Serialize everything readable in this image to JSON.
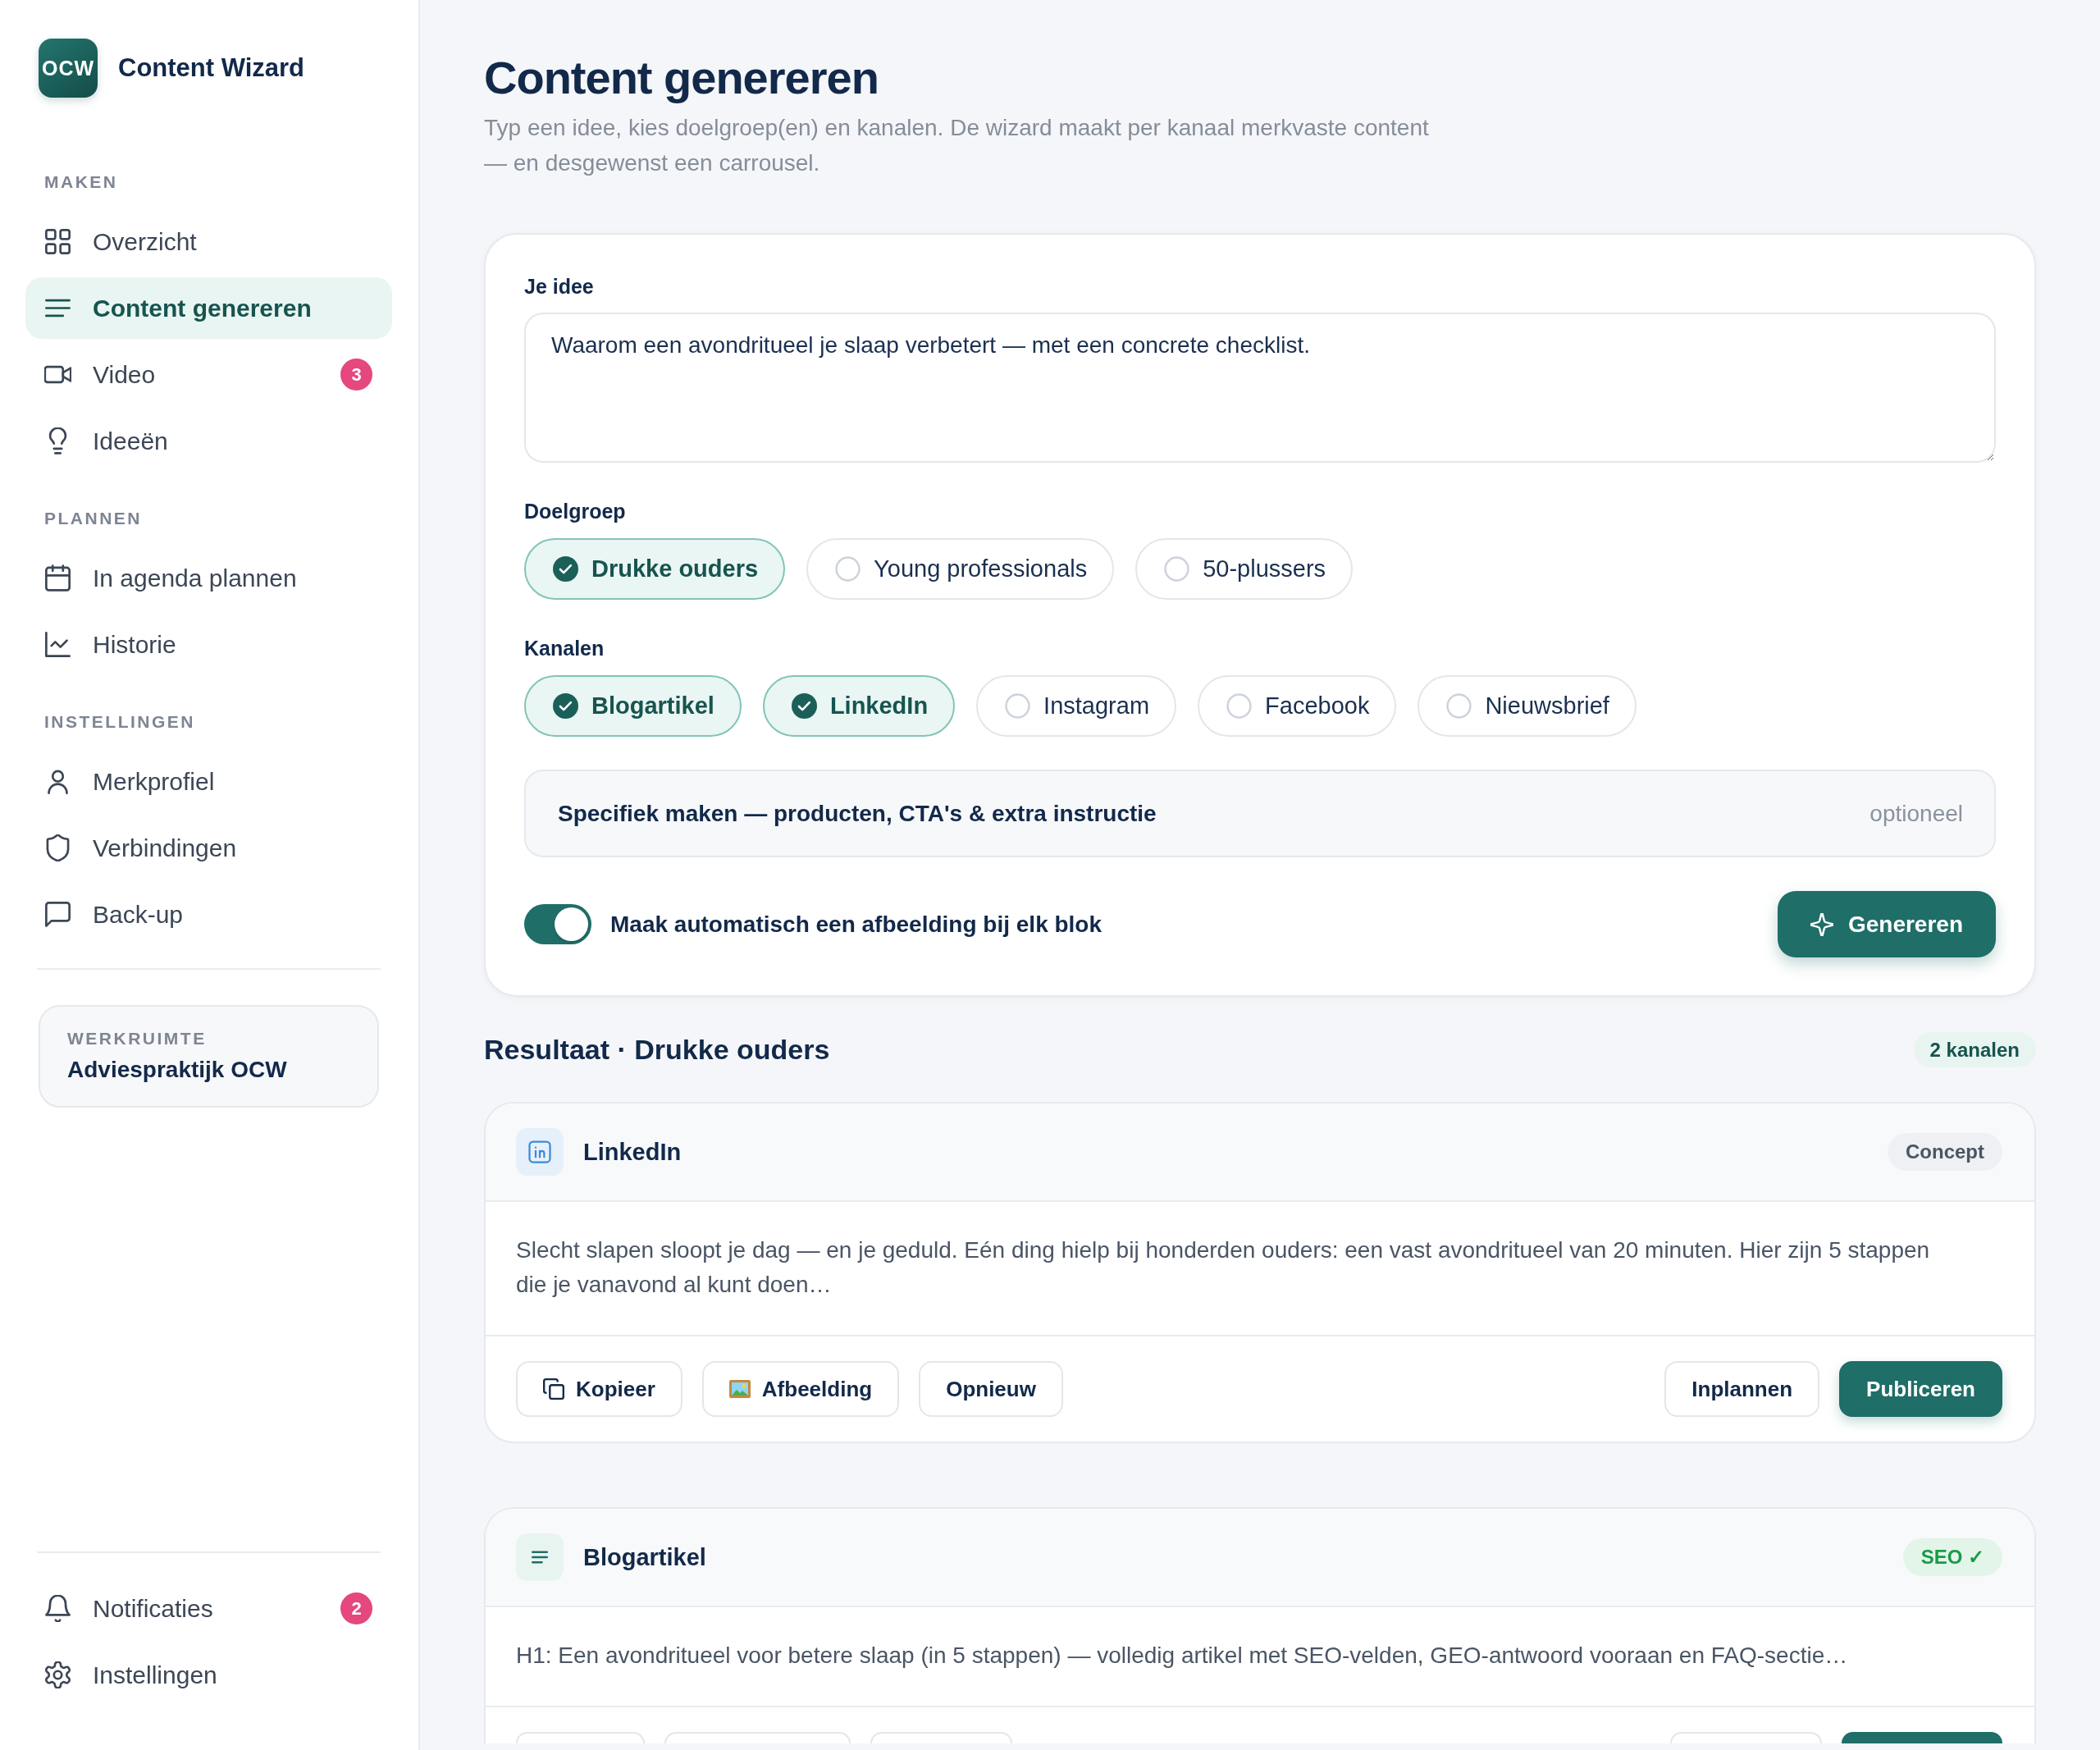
{
  "sidebar": {
    "logo": "OCW",
    "app_name": "Content Wizard",
    "sections": [
      {
        "label": "MAKEN",
        "items": [
          {
            "label": "Overzicht",
            "selected": false
          },
          {
            "label": "Content genereren",
            "selected": true
          },
          {
            "label": "Video",
            "selected": false,
            "badge": "3"
          },
          {
            "label": "Ideeën",
            "selected": false
          }
        ]
      },
      {
        "label": "PLANNEN",
        "items": [
          {
            "label": "In agenda plannen",
            "selected": false
          },
          {
            "label": "Historie",
            "selected": false
          }
        ]
      },
      {
        "label": "INSTELLINGEN",
        "items": [
          {
            "label": "Merkprofiel",
            "selected": false
          },
          {
            "label": "Verbindingen",
            "selected": false
          },
          {
            "label": "Back-up",
            "selected": false
          }
        ]
      }
    ],
    "workspace": {
      "label": "WERKRUIMTE",
      "name": "Adviespraktijk OCW"
    },
    "footer_items": [
      {
        "label": "Notificaties",
        "selected": false,
        "badge": "2"
      },
      {
        "label": "Instellingen",
        "selected": false
      }
    ]
  },
  "page": {
    "title": "Content genereren",
    "subtitle": "Typ een idee, kies doelgroep(en) en kanalen. De wizard maakt per kanaal merkvaste content — en desgewenst een carrousel."
  },
  "form": {
    "idea": {
      "label": "Je idee",
      "value": "Waarom een avondritueel je slaap verbetert — met een concrete checklist."
    },
    "audience": {
      "label": "Doelgroep",
      "options": [
        {
          "label": "Drukke ouders",
          "selected": true
        },
        {
          "label": "Young professionals",
          "selected": false
        },
        {
          "label": "50-plussers",
          "selected": false
        }
      ]
    },
    "channels": {
      "label": "Kanalen",
      "options": [
        {
          "label": "Blogartikel",
          "selected": true
        },
        {
          "label": "LinkedIn",
          "selected": true
        },
        {
          "label": "Instagram",
          "selected": false
        },
        {
          "label": "Facebook",
          "selected": false
        },
        {
          "label": "Nieuwsbrief",
          "selected": false
        }
      ]
    },
    "specific": {
      "title": "Specifiek maken — producten, CTA's & extra instructie",
      "hint": "optioneel"
    },
    "auto_image": {
      "label": "Maak automatisch een afbeelding bij elk blok",
      "on": true
    },
    "generate_button": {
      "label": "Genereren"
    }
  },
  "results": {
    "title": "Resultaat · Drukke ouders",
    "count": "2 kanalen",
    "cards": [
      {
        "kind": "linkedin",
        "title": "LinkedIn",
        "badge": {
          "label": "Concept",
          "kind": "neutral"
        },
        "text": "Slecht slapen sloopt je dag — en je geduld. Eén ding hielp bij honderden ouders: een vast avondritueel van 20 minuten. Hier zijn 5 stappen die je vanavond al kunt doen…",
        "actions_left": [
          {
            "kind": "copy",
            "label": "Kopieer"
          },
          {
            "kind": "image",
            "label": "Afbeelding"
          },
          {
            "kind": "plain",
            "label": "Opnieuw"
          }
        ],
        "actions_right": [
          {
            "kind": "plain",
            "label": "Inplannen"
          },
          {
            "kind": "primary",
            "label": "Publiceren"
          }
        ]
      },
      {
        "kind": "blog",
        "title": "Blogartikel",
        "badge": {
          "label": "SEO ✓",
          "kind": "success"
        },
        "text": "H1: Een avondritueel voor betere slaap (in 5 stappen) — volledig artikel met SEO-velden, GEO-antwoord vooraan en FAQ-sectie…",
        "actions_left": [
          {
            "kind": "plain"
          },
          {
            "kind": "plain"
          },
          {
            "kind": "plain"
          }
        ],
        "actions_right": [
          {
            "kind": "plain"
          },
          {
            "kind": "primary"
          }
        ]
      }
    ]
  }
}
